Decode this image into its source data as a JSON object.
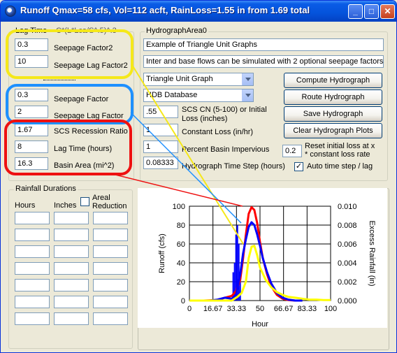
{
  "window": {
    "title": "Runoff Qmax=58 cfs, Vol=112 acft, RainLoss=1.55 in from 1.69 total",
    "controls": {
      "minimize": "_",
      "maximize": "□",
      "close": "✕"
    }
  },
  "lag_time_group": {
    "title": "Lag Time",
    "title_overflow": "C*(L*Lca/S^.5)^.3",
    "fields": [
      {
        "value": "0.3",
        "label": "Seepage Factor2"
      },
      {
        "value": "10",
        "label": "Seepage Lag Factor2"
      },
      {
        "value": "0.3",
        "label": "Seepage Factor"
      },
      {
        "value": "2",
        "label": "Seepage Lag Factor"
      },
      {
        "value": "1.67",
        "label": "SCS Recession Ratio"
      },
      {
        "value": "8",
        "label": "Lag Time (hours)"
      },
      {
        "value": "16.3",
        "label": "Basin Area (mi^2)"
      }
    ]
  },
  "hydrograph_area": {
    "title": "HydrographArea0",
    "name_value": "Example of Triangle Unit Graphs",
    "description_value": "Inter and base flows can be simulated with 2 optional seepage factors.",
    "unit_graph_select": "Triangle Unit Graph",
    "database_select": "HDB Database",
    "scs_cn_value": ".55",
    "scs_cn_label": "SCS CN (5-100) or Initial Loss (inches)",
    "constant_loss_value": "1",
    "constant_loss_label": "Constant Loss (in/hr)",
    "impervious_value": "1",
    "impervious_label": "Percent Basin Impervious",
    "time_step_value": "0.08333",
    "time_step_label": "Hydrograph Time Step (hours)",
    "reset_value": "0.2",
    "reset_label_line1": "Reset initial loss at x",
    "reset_label_line2": "* constant loss rate",
    "auto_time_step_label": "Auto time step / lag",
    "auto_time_step_checked": true,
    "buttons": {
      "compute": "Compute Hydrograph",
      "route": "Route Hydrograph",
      "save": "Save Hydrograph",
      "clear": "Clear Hydrograph Plots"
    }
  },
  "rainfall_group": {
    "title": "Rainfall Durations",
    "col_hours": "Hours",
    "col_inches": "Inches",
    "col_areal_line1": "Areal",
    "col_areal_line2": "Reduction",
    "areal_checked": false,
    "rows": 7
  },
  "chart_data": {
    "type": "line",
    "xlabel": "Hour",
    "ylabel": "Runoff (cfs)",
    "y2label": "Excess Rainfall (in)",
    "x_ticks": [
      "0",
      "16.67",
      "33.33",
      "50",
      "66.67",
      "83.33",
      "100"
    ],
    "y_ticks": [
      "0",
      "20",
      "40",
      "60",
      "80",
      "100"
    ],
    "y2_ticks": [
      "0.000",
      "0.002",
      "0.004",
      "0.006",
      "0.008",
      "0.010"
    ],
    "xlim": [
      0,
      100
    ],
    "ylim": [
      0,
      100
    ],
    "y2lim": [
      0,
      0.01
    ],
    "grid": true,
    "colors": {
      "red": "#ff0000",
      "blue": "#0000ff",
      "yellow": "#ffff00"
    },
    "series": [
      {
        "color": "#ff0000",
        "x": [
          0,
          10,
          20,
          25,
          30,
          33,
          36,
          38,
          40,
          42,
          44,
          46,
          48,
          50,
          52,
          55,
          58,
          62,
          66,
          70,
          75,
          80
        ],
        "y": [
          0,
          0,
          0.5,
          3,
          5,
          10,
          22,
          45,
          70,
          92,
          99,
          96,
          82,
          62,
          45,
          28,
          15,
          6,
          2,
          0.5,
          0,
          0
        ]
      },
      {
        "color": "#0000ff",
        "x": [
          0,
          15,
          20,
          25,
          30,
          33,
          36,
          38,
          40,
          42,
          44,
          46,
          48,
          50,
          52,
          55,
          58,
          62,
          66,
          70,
          75,
          80
        ],
        "y": [
          0,
          0,
          1,
          3,
          2,
          6,
          28,
          50,
          65,
          78,
          83,
          80,
          70,
          58,
          45,
          30,
          18,
          8,
          3,
          1,
          0,
          0
        ]
      },
      {
        "color": "#ffff00",
        "x": [
          0,
          30,
          34,
          37,
          40,
          42,
          44,
          46,
          48,
          50,
          54,
          58,
          62,
          66,
          70,
          75,
          80,
          85,
          90,
          95,
          100
        ],
        "y": [
          0,
          0,
          4,
          8,
          20,
          45,
          57,
          58,
          48,
          35,
          22,
          14,
          9,
          6,
          4,
          3,
          2,
          1,
          1,
          0.5,
          0.5
        ]
      }
    ],
    "rainfall_bars": {
      "x": [
        31,
        32,
        33,
        34,
        35,
        36
      ],
      "y": [
        0.003,
        0.004,
        0.007,
        0.008,
        0.006,
        0.002
      ]
    }
  }
}
